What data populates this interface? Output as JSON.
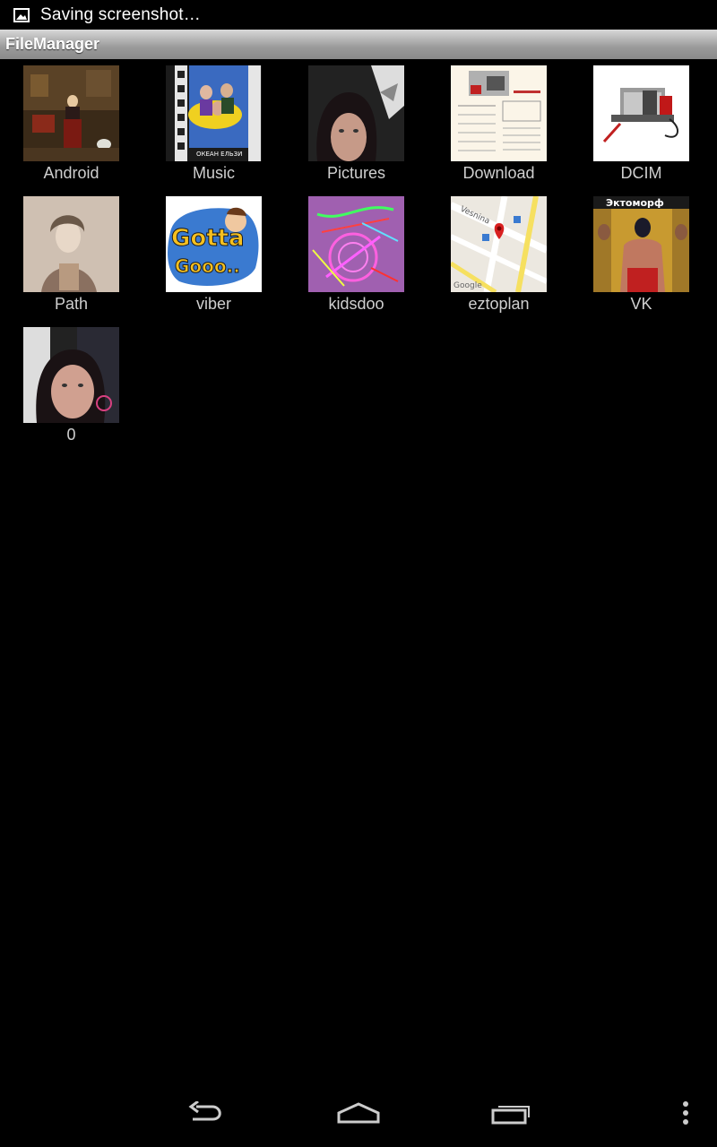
{
  "status_bar": {
    "notification_icon": "image-icon",
    "text": "Saving screenshot…"
  },
  "app": {
    "title": "FileManager"
  },
  "folders": [
    {
      "label": "Android",
      "thumbnail": "painting-thumbnail"
    },
    {
      "label": "Music",
      "thumbnail": "album-cover-thumbnail"
    },
    {
      "label": "Pictures",
      "thumbnail": "selfie-thumbnail"
    },
    {
      "label": "Download",
      "thumbnail": "document-thumbnail"
    },
    {
      "label": "DCIM",
      "thumbnail": "winch-thumbnail"
    },
    {
      "label": "Path",
      "thumbnail": "portrait-thumbnail"
    },
    {
      "label": "viber",
      "thumbnail": "sticker-thumbnail"
    },
    {
      "label": "kidsdoo",
      "thumbnail": "drawing-thumbnail"
    },
    {
      "label": "eztoplan",
      "thumbnail": "map-thumbnail"
    },
    {
      "label": "VK",
      "thumbnail": "gym-thumbnail"
    },
    {
      "label": "0",
      "thumbnail": "selfie-thumbnail"
    }
  ],
  "thumb_text": {
    "music_caption": "ОКЕАН ЕЛЬЗИ",
    "map_street": "Vesnina",
    "map_brand": "Google",
    "vk_caption": "Эктоморф"
  },
  "nav_bar": {
    "back_icon": "back-icon",
    "home_icon": "home-icon",
    "recents_icon": "recent-apps-icon",
    "menu_icon": "overflow-menu-icon"
  }
}
